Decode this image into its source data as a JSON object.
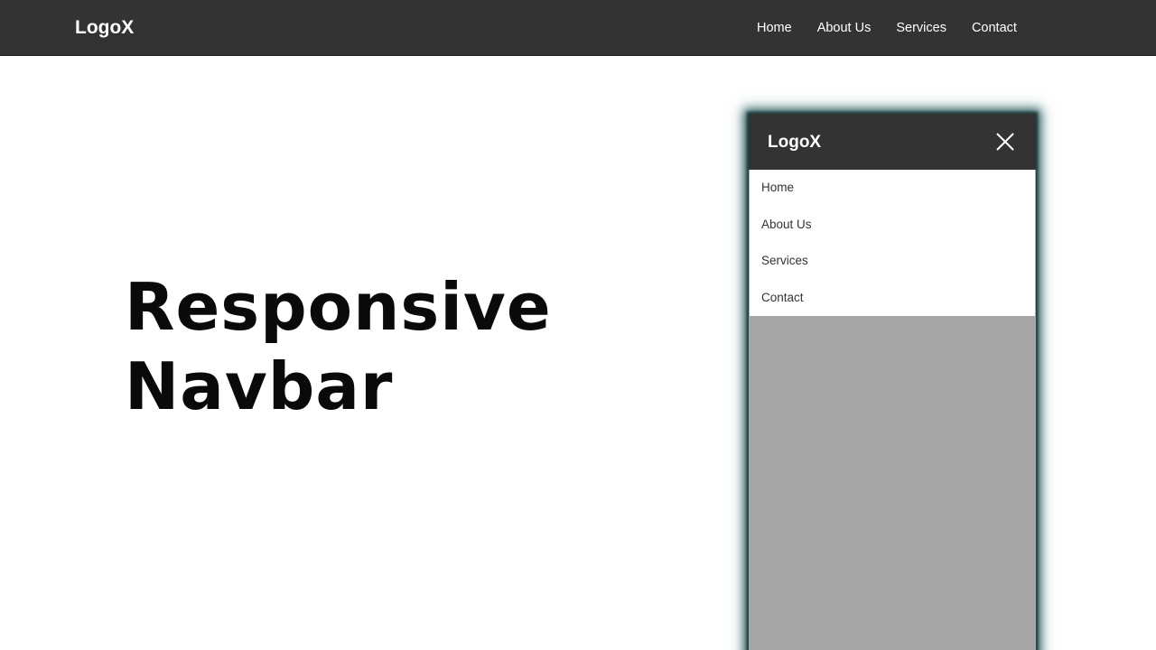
{
  "navbar": {
    "logo": "LogoX",
    "links": [
      "Home",
      "About Us",
      "Services",
      "Contact"
    ]
  },
  "hero": {
    "line1": "Responsive",
    "line2": "Navbar"
  },
  "mobile": {
    "logo": "LogoX",
    "close_icon": "close-icon",
    "links": [
      "Home",
      "About Us",
      "Services",
      "Contact"
    ]
  },
  "colors": {
    "navbar_bg": "#333333",
    "menu_bg": "#ffffff",
    "overlay_bg": "#a6a6a6",
    "text_light": "#ffffff",
    "text_dark": "#333333",
    "glow": "#2f5f5f"
  }
}
